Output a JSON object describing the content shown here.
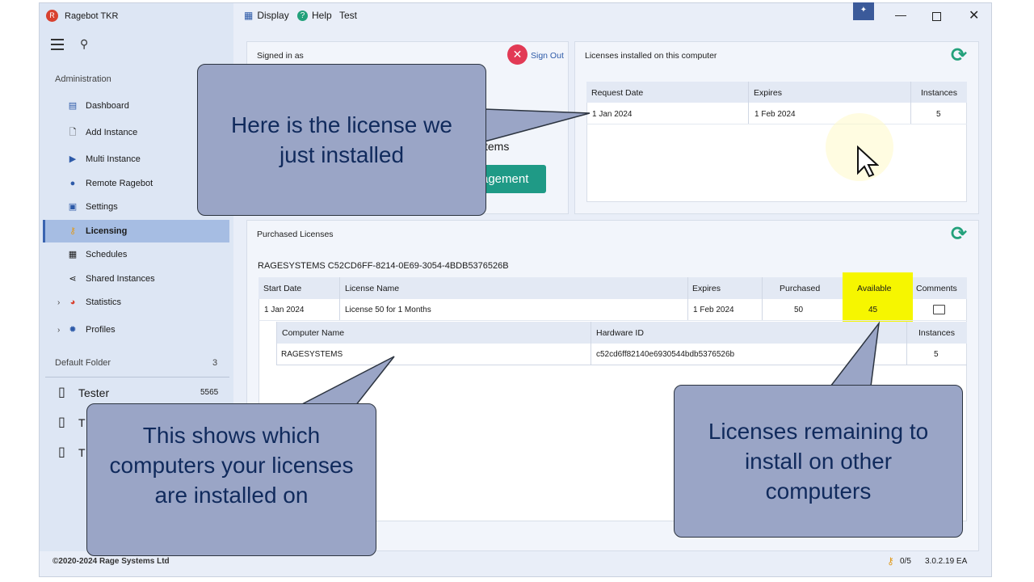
{
  "app": {
    "title": "Ragebot TKR"
  },
  "menu": {
    "display": "Display",
    "help": "Help",
    "test": "Test"
  },
  "sidebar": {
    "admin_label": "Administration",
    "items": [
      {
        "label": "Dashboard"
      },
      {
        "label": "Add Instance"
      },
      {
        "label": "Multi Instance"
      },
      {
        "label": "Remote Ragebot"
      },
      {
        "label": "Settings"
      },
      {
        "label": "Licensing"
      },
      {
        "label": "Schedules"
      },
      {
        "label": "Shared Instances"
      },
      {
        "label": "Statistics"
      },
      {
        "label": "Profiles"
      }
    ],
    "folder_label": "Default Folder",
    "folder_count": "3",
    "devices": [
      {
        "name": "Tester",
        "count": "5565"
      },
      {
        "name": "T",
        "count": ""
      },
      {
        "name": "T",
        "count": ""
      }
    ]
  },
  "signed_in": {
    "title": "Signed in as",
    "sign_out": "Sign Out",
    "partial_text": "stems",
    "partial_button": "agement"
  },
  "installed": {
    "title": "Licenses installed on this computer",
    "columns": [
      "Request Date",
      "Expires",
      "Instances"
    ],
    "rows": [
      {
        "request_date": "1 Jan 2024",
        "expires": "1 Feb 2024",
        "instances": "5"
      }
    ]
  },
  "purchased": {
    "title": "Purchased Licenses",
    "account": "RAGESYSTEMS C52CD6FF-8214-0E69-3054-4BDB5376526B",
    "columns": [
      "Start Date",
      "License Name",
      "Expires",
      "Purchased",
      "Available",
      "Comments"
    ],
    "rows": [
      {
        "start_date": "1 Jan 2024",
        "license_name": "License 50 for 1 Months",
        "expires": "1 Feb 2024",
        "purchased": "50",
        "available": "45"
      }
    ],
    "sub_columns": [
      "Computer Name",
      "Hardware ID",
      "Instances"
    ],
    "sub_rows": [
      {
        "computer": "RAGESYSTEMS",
        "hardware_id": "c52cd6ff82140e6930544bdb5376526b",
        "instances": "5"
      }
    ]
  },
  "callouts": {
    "installed": "Here is the license we just installed",
    "computers": "This shows which computers your licenses are installed on",
    "remaining": "Licenses remaining to install on other computers"
  },
  "footer": {
    "copyright": "©2020-2024 Rage Systems Ltd",
    "license_status": "0/5",
    "version": "3.0.2.19 EA"
  },
  "colors": {
    "accent": "#3a64b0",
    "refresh": "#23a17b",
    "highlight": "#f6f600",
    "callout": "#9aa5c6"
  }
}
